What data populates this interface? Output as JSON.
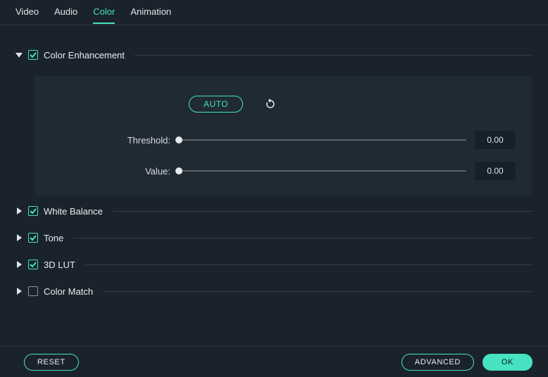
{
  "tabs": {
    "video": "Video",
    "audio": "Audio",
    "color": "Color",
    "animation": "Animation",
    "active": "color"
  },
  "sections": {
    "color_enhancement": {
      "title": "Color Enhancement",
      "checked": true,
      "expanded": true,
      "auto_label": "AUTO",
      "threshold_label": "Threshold:",
      "threshold_value": "0.00",
      "value_label": "Value:",
      "value_value": "0.00"
    },
    "white_balance": {
      "title": "White Balance",
      "checked": true,
      "expanded": false
    },
    "tone": {
      "title": "Tone",
      "checked": true,
      "expanded": false
    },
    "lut": {
      "title": "3D LUT",
      "checked": true,
      "expanded": false
    },
    "color_match": {
      "title": "Color Match",
      "checked": false,
      "expanded": false
    }
  },
  "footer": {
    "reset": "RESET",
    "advanced": "ADVANCED",
    "ok": "OK"
  }
}
